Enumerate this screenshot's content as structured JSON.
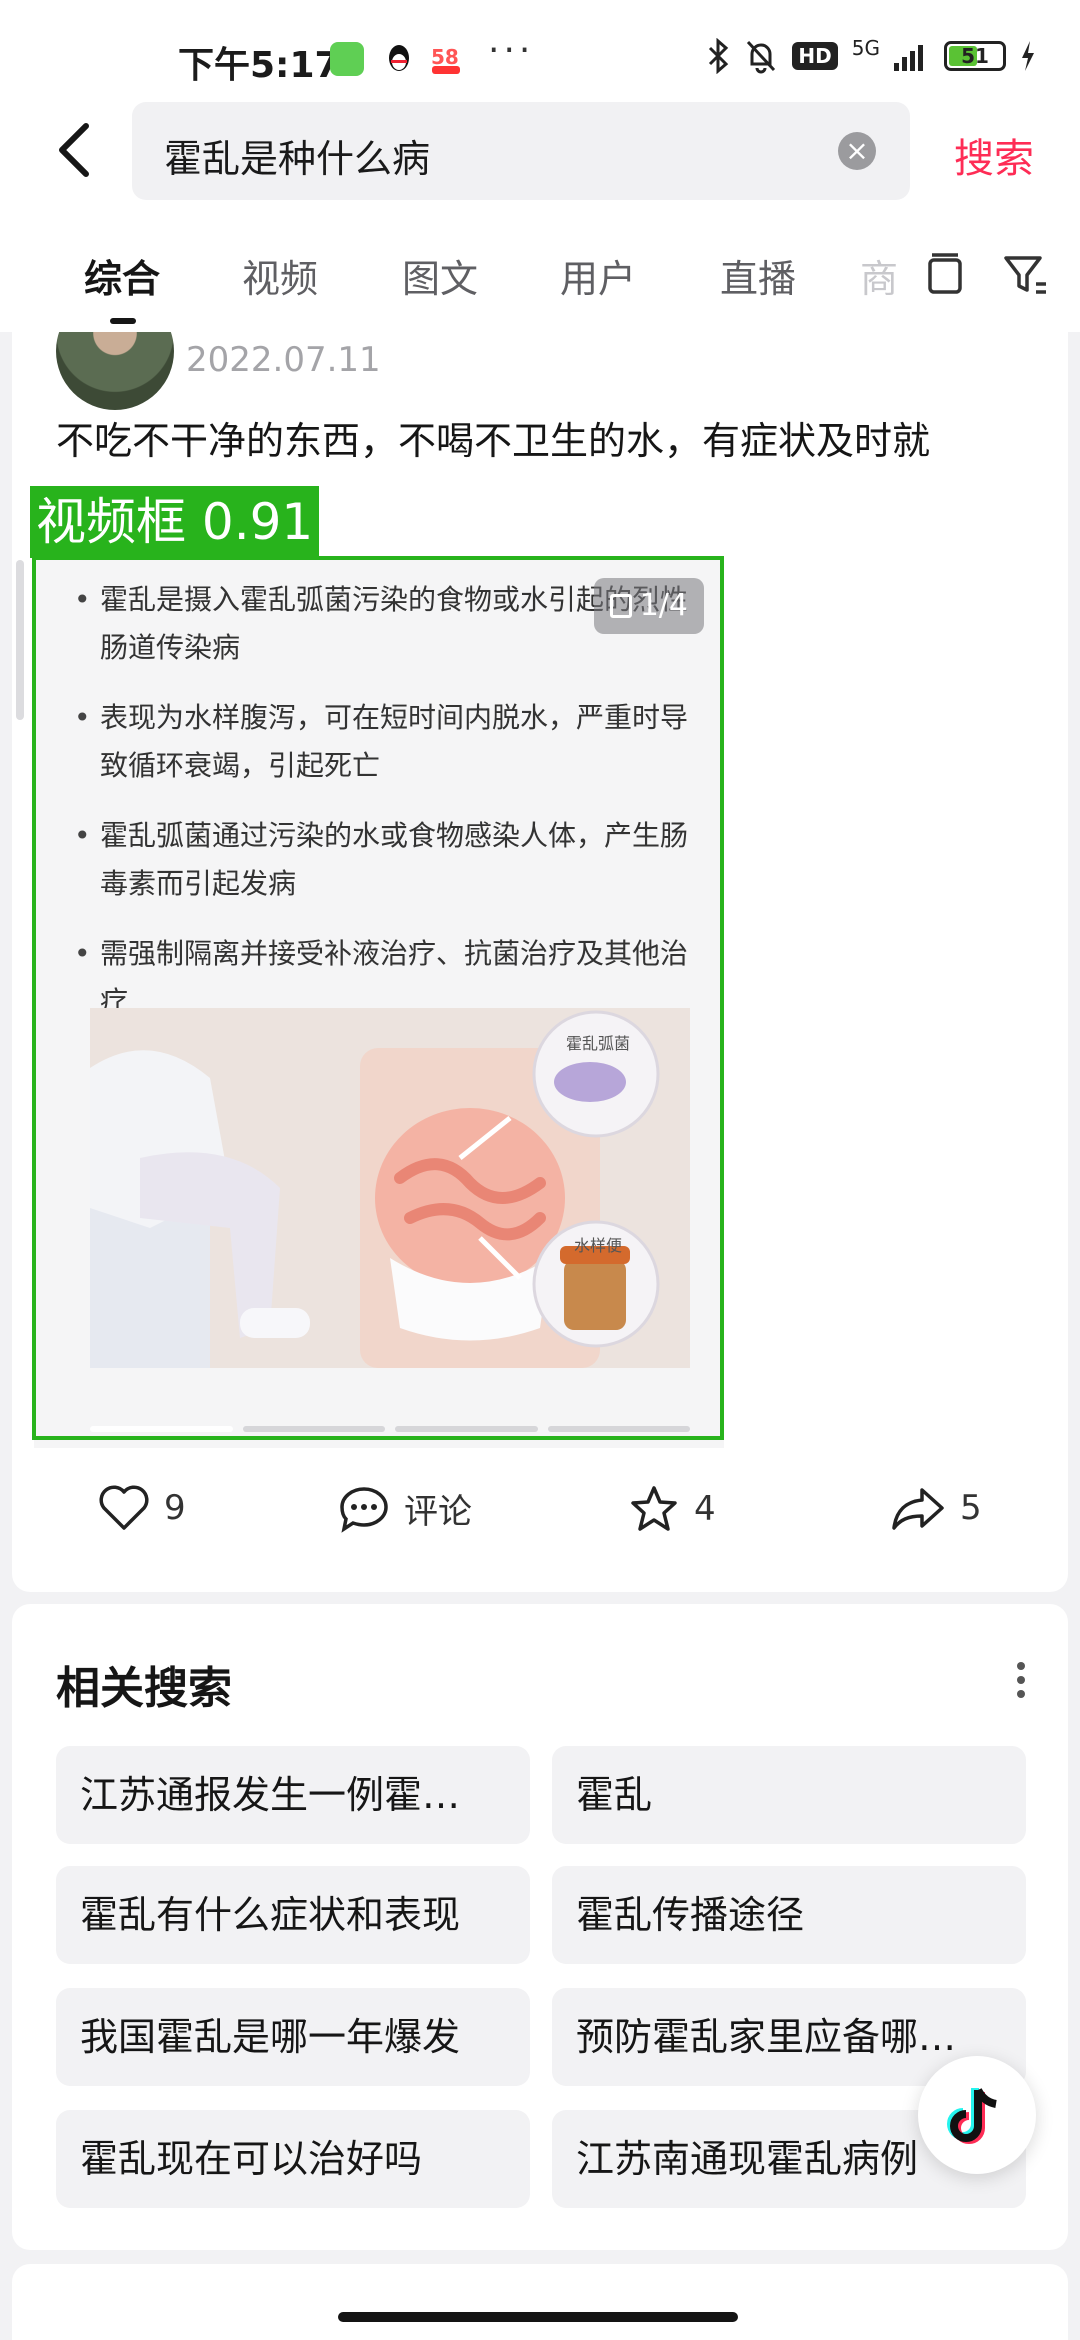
{
  "status_bar": {
    "time": "下午5:17",
    "dots": "···",
    "signal": "5G",
    "hd": "HD",
    "battery": "51"
  },
  "header": {
    "search_query": "霍乱是种什么病",
    "search_button": "搜索"
  },
  "tabs": [
    {
      "label": "综合",
      "active": true
    },
    {
      "label": "视频",
      "active": false
    },
    {
      "label": "图文",
      "active": false
    },
    {
      "label": "用户",
      "active": false
    },
    {
      "label": "直播",
      "active": false
    },
    {
      "label": "商",
      "active": false
    }
  ],
  "post": {
    "date": "2022.07.11",
    "text": "不吃不干净的东西，不喝不卫生的水，有症状及时就",
    "image_counter": "1/4",
    "bullets": [
      "霍乱是摄入霍乱弧菌污染的食物或水引起的烈性肠道传染病",
      "表现为水样腹泻，可在短时间内脱水，严重时导致循环衰竭，引起死亡",
      "霍乱弧菌通过污染的水或食物感染人体，产生肠毒素而引起发病",
      "需强制隔离并接受补液治疗、抗菌治疗及其他治疗"
    ],
    "illustration_labels": {
      "bacteria": "霍乱弧菌",
      "stool": "水样便"
    },
    "detection_label": "视频框 0.91",
    "actions": {
      "likes": "9",
      "comment_label": "评论",
      "favorites": "4",
      "shares": "5"
    }
  },
  "related": {
    "title": "相关搜索",
    "items": [
      "江苏通报发生一例霍…",
      "霍乱",
      "霍乱有什么症状和表现",
      "霍乱传播途径",
      "我国霍乱是哪一年爆发",
      "预防霍乱家里应备哪…",
      "霍乱现在可以治好吗",
      "江苏南通现霍乱病例"
    ]
  },
  "colors": {
    "accent": "#fe2c55",
    "detection_box": "#28b31c"
  }
}
